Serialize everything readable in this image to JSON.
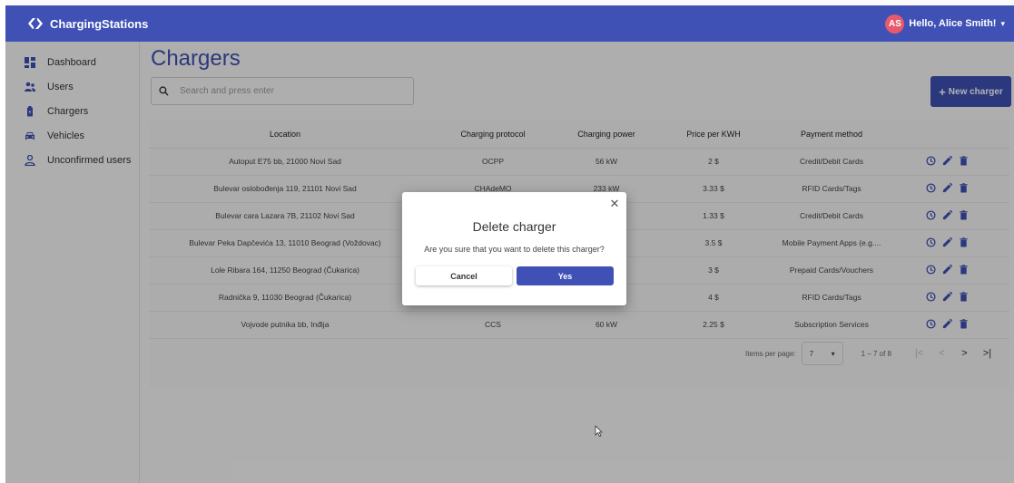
{
  "header": {
    "brand": "ChargingStations",
    "avatar_initials": "AS",
    "greeting": "Hello, Alice Smith!",
    "colors": {
      "primary": "#3f51b5",
      "avatar": "#e75a6c"
    }
  },
  "sidebar": {
    "items": [
      {
        "label": "Dashboard",
        "icon": "dashboard-icon"
      },
      {
        "label": "Users",
        "icon": "users-icon"
      },
      {
        "label": "Chargers",
        "icon": "charger-icon"
      },
      {
        "label": "Vehicles",
        "icon": "vehicle-icon"
      },
      {
        "label": "Unconfirmed users",
        "icon": "person-icon"
      }
    ]
  },
  "main": {
    "title": "Chargers",
    "search_placeholder": "Search and press enter",
    "new_button": "New charger"
  },
  "table": {
    "columns": [
      "Location",
      "Charging protocol",
      "Charging power",
      "Price per KWH",
      "Payment method"
    ],
    "rows": [
      [
        "Autoput E75 bb, 21000 Novi Sad",
        "OCPP",
        "56 kW",
        "2 $",
        "Credit/Debit Cards"
      ],
      [
        "Bulevar oslobođenja 119, 21101 Novi Sad",
        "CHAdeMO",
        "233 kW",
        "3.33 $",
        "RFID Cards/Tags"
      ],
      [
        "Bulevar cara Lazara 7B, 21102 Novi Sad",
        "",
        "",
        "1.33 $",
        "Credit/Debit Cards"
      ],
      [
        "Bulevar Peka Dapčevića 13, 11010 Beograd (Voždovac)",
        "",
        "",
        "3.5 $",
        "Mobile Payment Apps (e.g...."
      ],
      [
        "Lole Ribara 164, 11250 Beograd (Čukarica)",
        "",
        "",
        "3 $",
        "Prepaid Cards/Vouchers"
      ],
      [
        "Radnička 9, 11030 Beograd (Čukarica)",
        "",
        "",
        "4 $",
        "RFID Cards/Tags"
      ],
      [
        "Vojvode putnika bb, Inđija",
        "CCS",
        "60 kW",
        "2.25 $",
        "Subscription Services"
      ]
    ]
  },
  "paginator": {
    "label": "Items per page:",
    "page_size": "7",
    "range": "1 – 7 of 8"
  },
  "dialog": {
    "title": "Delete charger",
    "message": "Are you sure that you want to delete this charger?",
    "cancel": "Cancel",
    "confirm": "Yes"
  }
}
